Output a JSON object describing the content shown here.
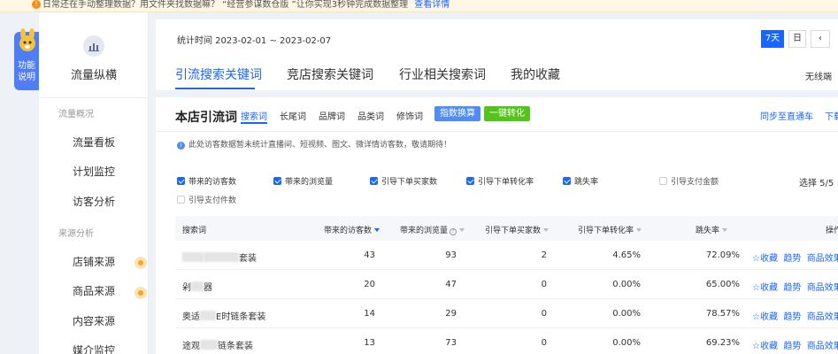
{
  "notice": {
    "text": "日常还在手动整理数据？用文件夹找数据嘛？ “经营参谋数仓版 ”让你实现3秒钟完成数据整理",
    "link": "查看详情"
  },
  "function_badge": "功能说明",
  "sidebar": {
    "title": "流量纵横",
    "groups": [
      {
        "label": "流量概况",
        "items": [
          "流量看板",
          "计划监控",
          "访客分析"
        ]
      },
      {
        "label": "来源分析",
        "items": [
          "店铺来源",
          "商品来源",
          "内容来源",
          "媒介监控"
        ]
      }
    ]
  },
  "header": {
    "stat_time": "统计时间 2023-02-01 ~ 2023-02-07",
    "periods": [
      "7天",
      "日"
    ],
    "active_period": "7天",
    "no_wireless": "无线端"
  },
  "tabs": [
    "引流搜索关键词",
    "竞店搜索关键词",
    "行业相关搜索词",
    "我的收藏"
  ],
  "active_tab": "引流搜索关键词",
  "card": {
    "title": "本店引流词",
    "keyword_tabs": [
      "搜索词",
      "长尾词",
      "品牌词",
      "品类词",
      "修饰词"
    ],
    "active_keyword_tab": "搜索词",
    "btn_index": "指数换算",
    "btn_convert": "一键转化",
    "sync": "同步至直通车",
    "download": "下载"
  },
  "info": "此处访客数据暂未统计直播间、短视频、图文、微详情访客数，敬请期待！",
  "checkboxes": [
    {
      "label": "带来的访客数",
      "checked": true
    },
    {
      "label": "带来的浏览量",
      "checked": true
    },
    {
      "label": "引导下单买家数",
      "checked": true
    },
    {
      "label": "引导下单转化率",
      "checked": true
    },
    {
      "label": "跳失率",
      "checked": true
    },
    {
      "label": "引导支付金额",
      "checked": false
    },
    {
      "label": "引导支付件数",
      "checked": false
    }
  ],
  "select_count": "选择 5/5",
  "table": {
    "headers": [
      "搜索词",
      "带来的访客数",
      "带来的浏览量",
      "引导下单买家数",
      "引导下单转化率",
      "跳失率",
      "操作"
    ],
    "rows": [
      {
        "keyword_a": "",
        "keyword_b": "套装",
        "visitors": "43",
        "views": "93",
        "buyers": "2",
        "conv": "4.65%",
        "bounce": "72.09%"
      },
      {
        "keyword_a": "剁",
        "keyword_b": "器",
        "visitors": "20",
        "views": "47",
        "buyers": "0",
        "conv": "0.00%",
        "bounce": "65.00%"
      },
      {
        "keyword_a": "奥适",
        "keyword_b": "E时链条套装",
        "visitors": "14",
        "views": "29",
        "buyers": "0",
        "conv": "0.00%",
        "bounce": "78.57%"
      },
      {
        "keyword_a": "途观",
        "keyword_b": "链条套装",
        "visitors": "13",
        "views": "73",
        "buyers": "0",
        "conv": "0.00%",
        "bounce": "69.23%"
      }
    ],
    "actions": {
      "collect": "收藏",
      "trend": "趋势",
      "effect": "商品效果"
    }
  }
}
